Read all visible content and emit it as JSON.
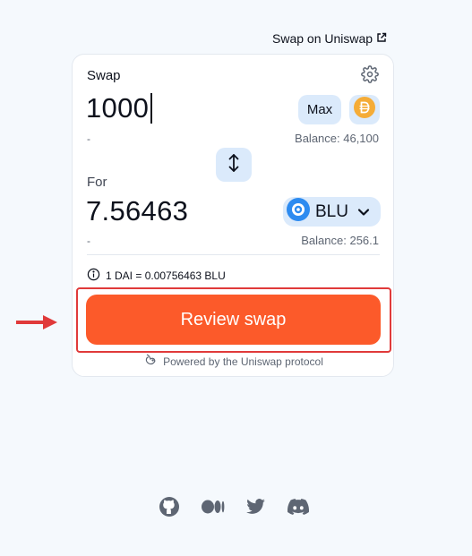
{
  "header": {
    "swap_link": "Swap on Uniswap"
  },
  "widget": {
    "title": "Swap",
    "input": {
      "amount": "1000",
      "usd_value": "-",
      "max_label": "Max",
      "token_icon": "dai-icon",
      "balance": "Balance: 46,100"
    },
    "output": {
      "label": "For",
      "amount": "7.56463",
      "usd_value": "-",
      "token_symbol": "BLU",
      "token_icon": "blu-icon",
      "balance": "Balance: 256.1"
    },
    "rate": "1 DAI = 0.00756463 BLU",
    "review_label": "Review swap",
    "powered_by": "Powered by the Uniswap protocol"
  },
  "colors": {
    "accent": "#fc5a2a",
    "button_bg": "#dbeafb",
    "highlight": "#e03a3a",
    "page_bg": "#f5f9fd"
  },
  "footer": {
    "icons": [
      "github-icon",
      "medium-icon",
      "twitter-icon",
      "discord-icon"
    ]
  }
}
